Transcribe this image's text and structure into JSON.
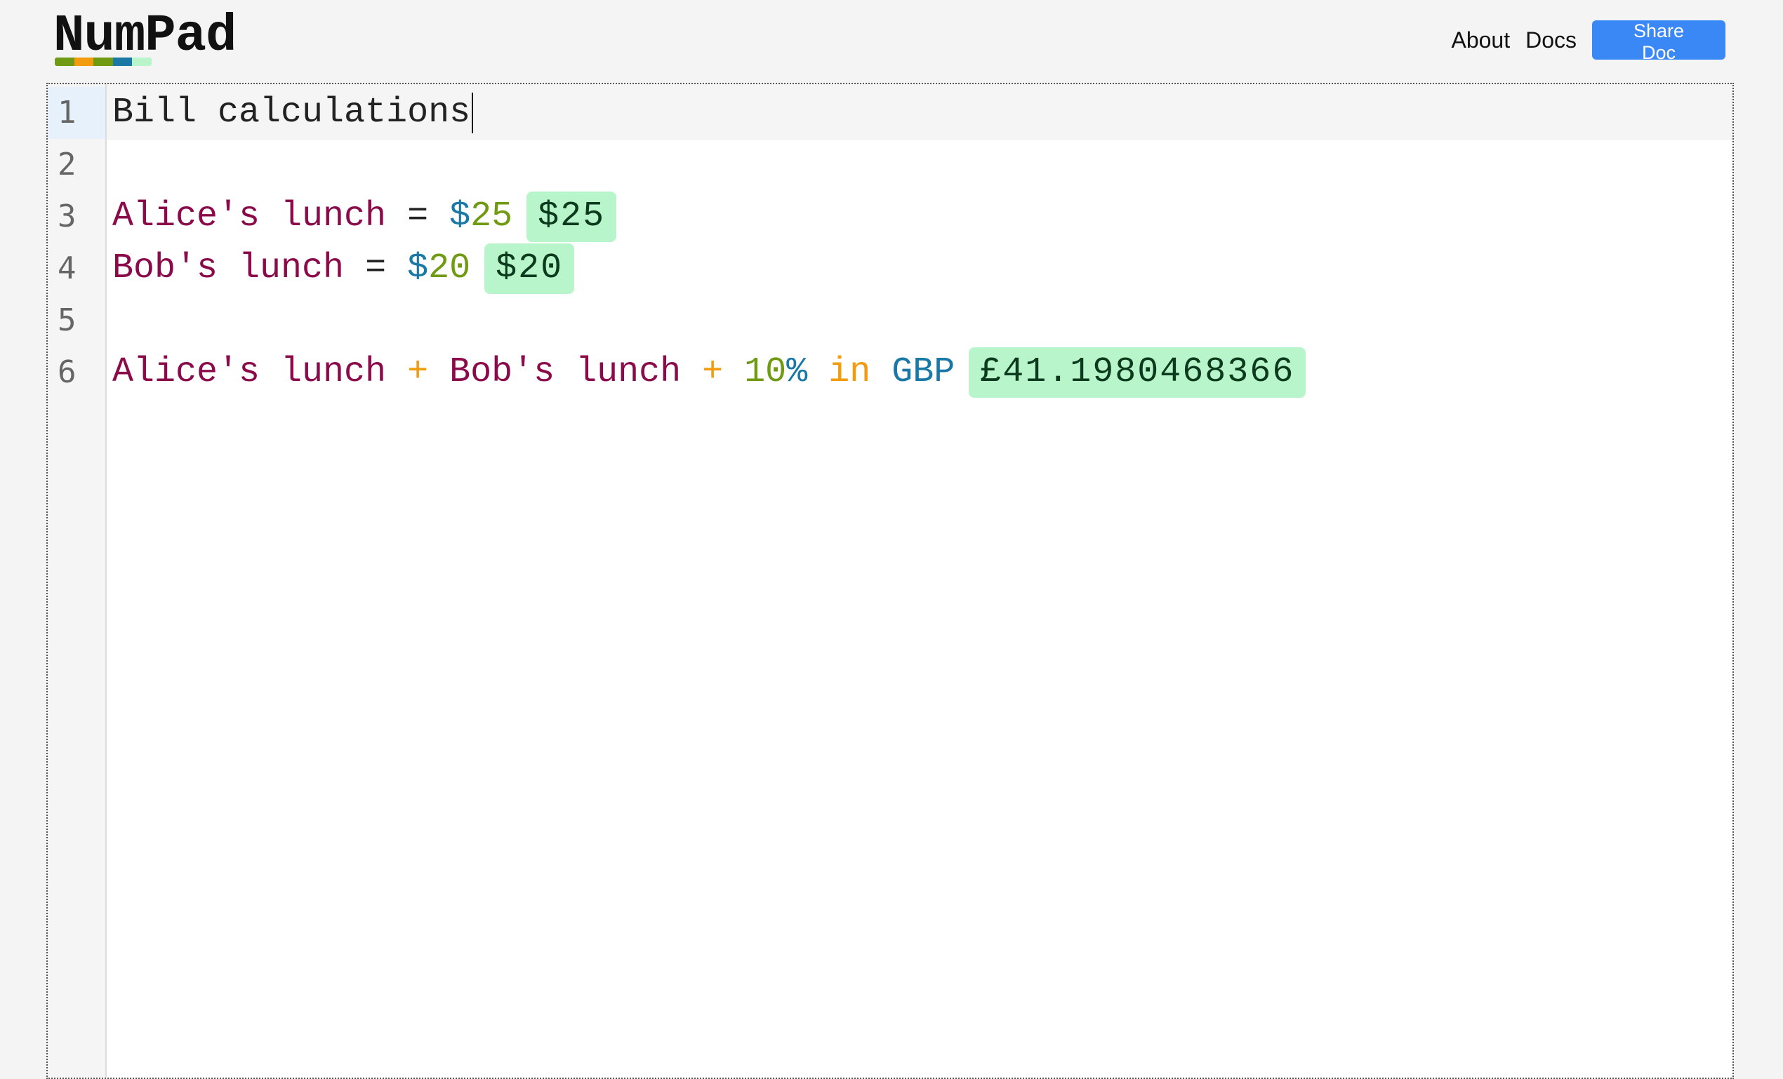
{
  "logo": {
    "text": "NumPad",
    "bar_colors": [
      "#6f9a12",
      "#f29b0c",
      "#6f9a12",
      "#1a78a6",
      "#b8f5cb"
    ]
  },
  "nav": {
    "about": "About",
    "docs": "Docs",
    "share": "Share Doc"
  },
  "editor": {
    "line_numbers": [
      "1",
      "2",
      "3",
      "4",
      "5",
      "6"
    ],
    "active_line": 1,
    "lines": [
      {
        "text": "Bill calculations"
      },
      {
        "text": ""
      },
      {
        "var": "Alice's lunch",
        "eq": " = ",
        "unit": "$",
        "num": "25",
        "result": "$25"
      },
      {
        "var": "Bob's lunch",
        "eq": " = ",
        "unit": "$",
        "num": "20",
        "result": "$20"
      },
      {
        "text": ""
      },
      {
        "var1": "Alice's lunch",
        "op1": " + ",
        "var2": "Bob's lunch",
        "op2": " + ",
        "num": "10",
        "pct": "%",
        "kw": " in ",
        "unit": "GBP",
        "result": "£41.1980468366"
      }
    ]
  },
  "colors": {
    "variable": "#8a0a4a",
    "unit": "#1a78a6",
    "number": "#6f9a12",
    "operator": "#f29b0c",
    "result_bg": "#b8f5cb",
    "share_button": "#3a88f5"
  }
}
